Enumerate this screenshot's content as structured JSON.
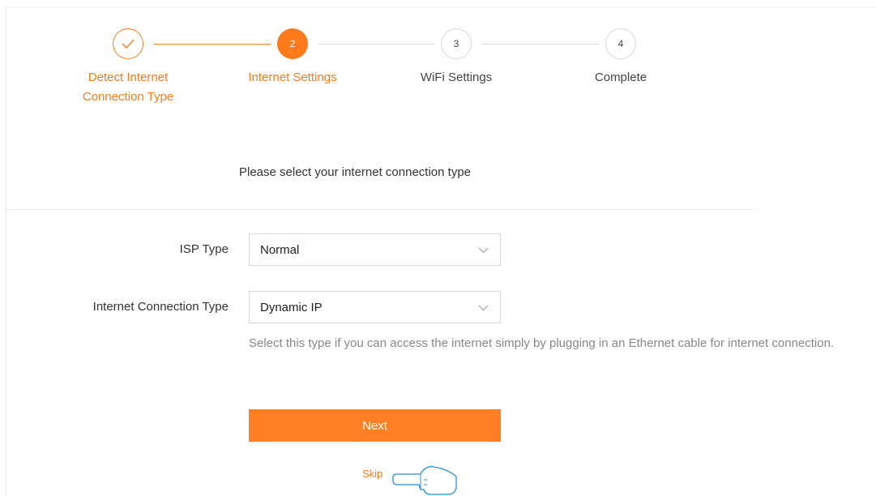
{
  "wizard": {
    "steps": [
      {
        "number": "1",
        "label_line1": "Detect Internet",
        "label_line2": "Connection Type",
        "state": "done"
      },
      {
        "number": "2",
        "label": "Internet Settings",
        "state": "active"
      },
      {
        "number": "3",
        "label": "WiFi Settings",
        "state": "todo"
      },
      {
        "number": "4",
        "label": "Complete",
        "state": "todo"
      }
    ]
  },
  "heading": "Please select your internet connection type",
  "form": {
    "isp_type": {
      "label": "ISP Type",
      "value": "Normal"
    },
    "connection_type": {
      "label": "Internet Connection Type",
      "value": "Dynamic IP"
    },
    "hint": "Select this type if you can access the internet simply by plugging in an Ethernet cable for internet connection."
  },
  "actions": {
    "next_label": "Next",
    "skip_label": "Skip"
  },
  "colors": {
    "accent": "#ff7a1a",
    "inactive": "#d9d9d9"
  },
  "icons": {
    "done_step": "check-icon",
    "dropdown": "chevron-down-icon",
    "pointer": "pointing-hand-icon"
  }
}
